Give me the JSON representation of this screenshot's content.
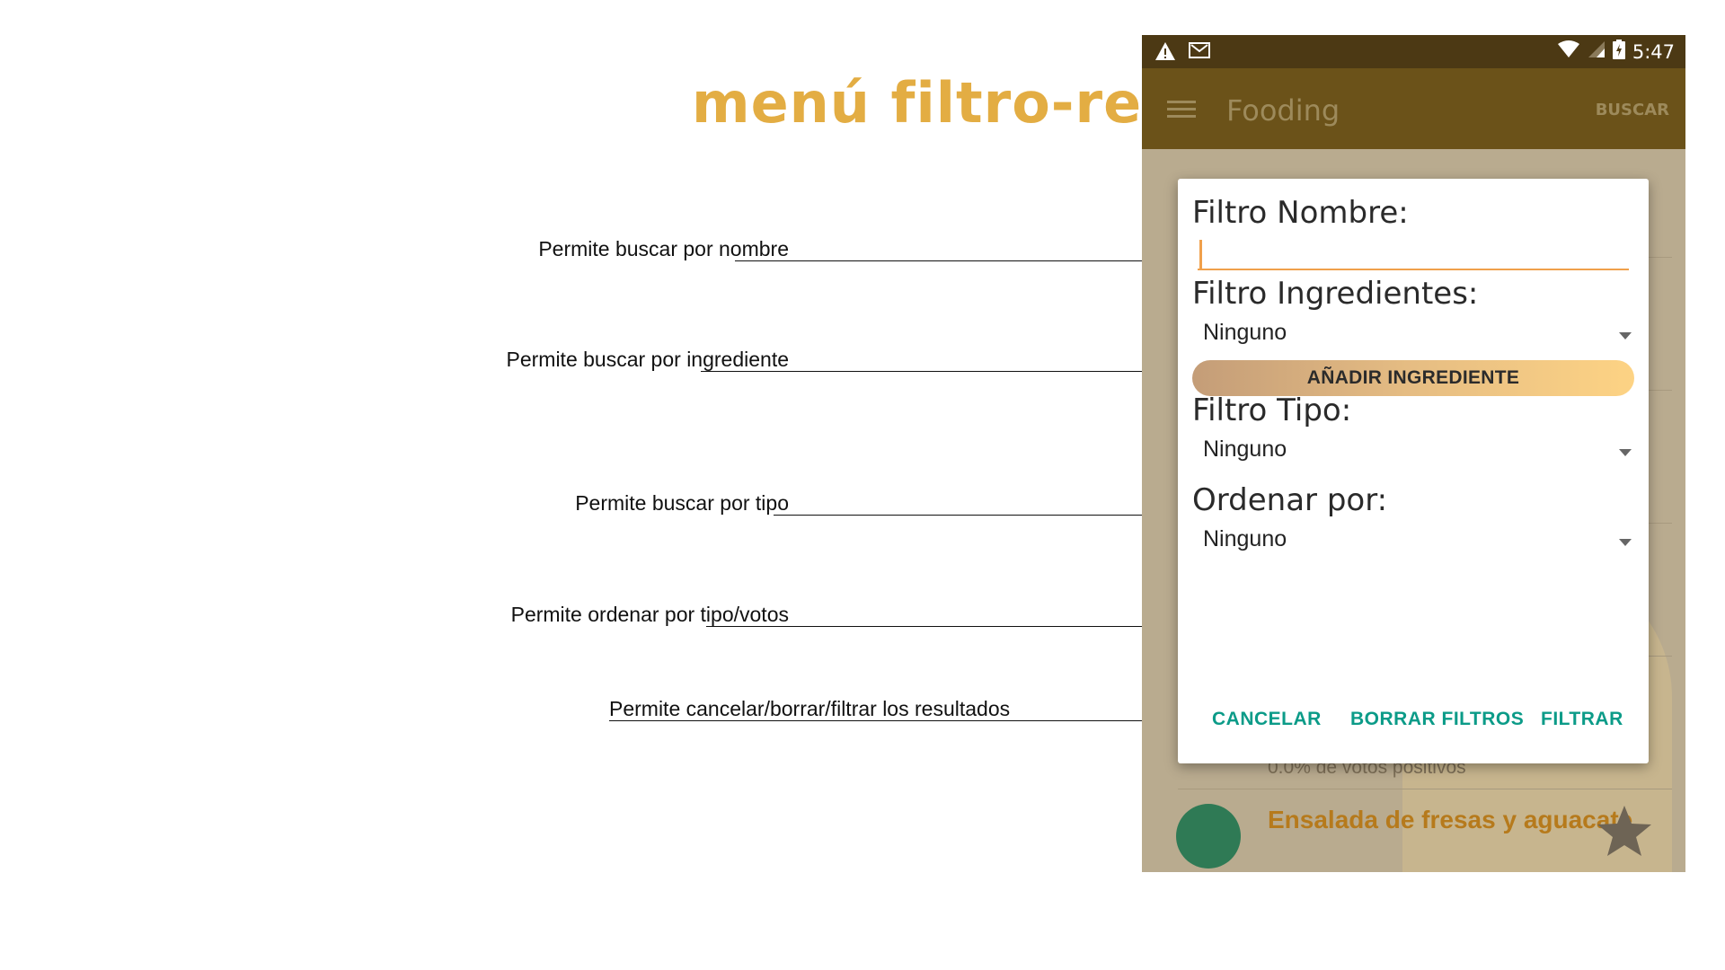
{
  "slide": {
    "title": "menú filtro-recetas",
    "annotations": [
      "Permite buscar por nombre",
      "Permite buscar por ingrediente",
      "Permite buscar por tipo",
      "Permite ordenar por tipo/votos",
      "Permite cancelar/borrar/filtrar los resultados"
    ]
  },
  "statusbar": {
    "time": "5:47"
  },
  "appbar": {
    "title": "Fooding",
    "search_action": "BUSCAR"
  },
  "background": {
    "votes_text": "0.0% de votos positivos",
    "recipe_name": "Ensalada de fresas y aguacate"
  },
  "dialog": {
    "name_label": "Filtro Nombre:",
    "name_value": "",
    "ingredients_label": "Filtro Ingredientes:",
    "ingredients_value": "Ninguno",
    "add_ingredient": "AÑADIR INGREDIENTE",
    "type_label": "Filtro Tipo:",
    "type_value": "Ninguno",
    "order_label": "Ordenar por:",
    "order_value": "Ninguno",
    "cancel": "CANCELAR",
    "clear": "BORRAR FILTROS",
    "filter": "FILTRAR"
  },
  "colors": {
    "title_accent": "#e3ad43",
    "statusbar": "#4c3914",
    "appbar": "#6b5219",
    "input_underline": "#f0a04b",
    "action_text": "#0b9b88"
  }
}
